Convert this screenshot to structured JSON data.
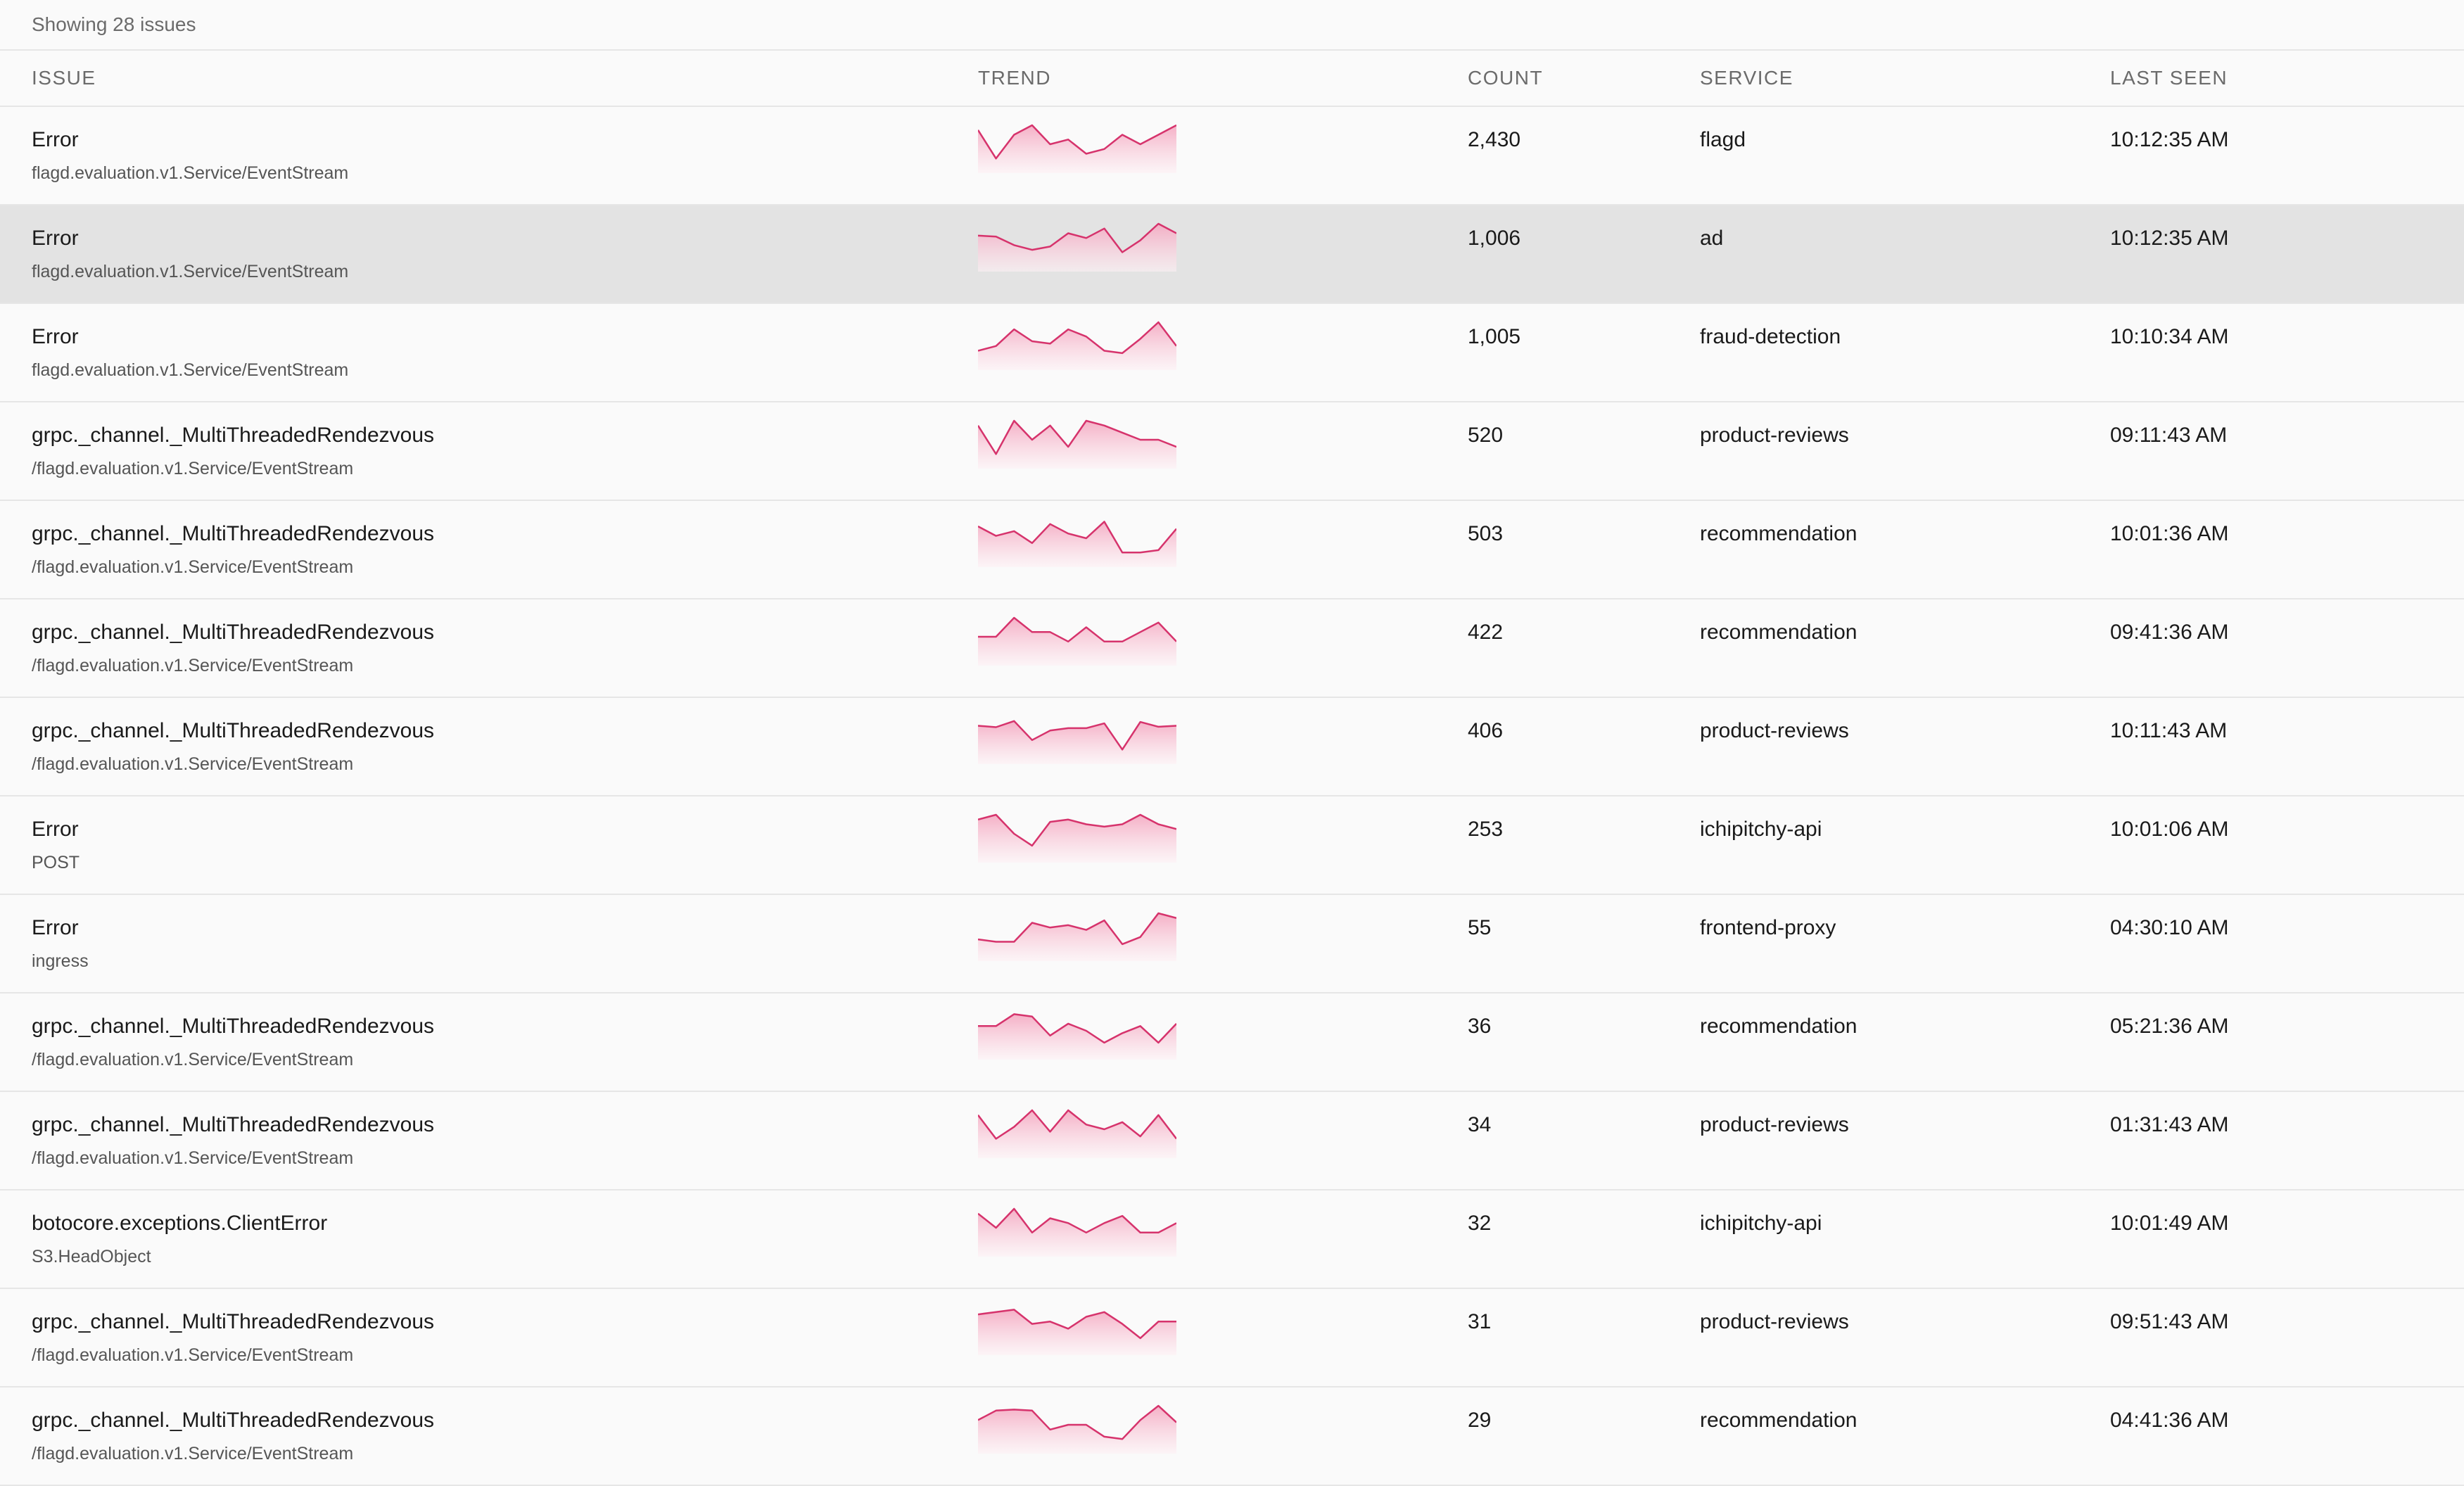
{
  "summary": "Showing 28 issues",
  "columns": {
    "issue": "ISSUE",
    "trend": "TREND",
    "count": "COUNT",
    "service": "SERVICE",
    "last_seen": "LAST SEEN"
  },
  "colors": {
    "sparkline_stroke": "#d6336c",
    "sparkline_fill_top": "#f4a7c0",
    "sparkline_fill_bottom": "#fdf0f4",
    "selected_row_bg": "#e3e3e3"
  },
  "rows": [
    {
      "title": "Error",
      "subtitle": "flagd.evaluation.v1.Service/EventStream",
      "count": "2,430",
      "service": "flagd",
      "last_seen": "10:12:35 AM",
      "selected": false,
      "trend": [
        7,
        1,
        6,
        8,
        4,
        5,
        2,
        3,
        6,
        4,
        6,
        8
      ]
    },
    {
      "title": "Error",
      "subtitle": "flagd.evaluation.v1.Service/EventStream",
      "count": "1,006",
      "service": "ad",
      "last_seen": "10:12:35 AM",
      "selected": true,
      "trend": [
        5.5,
        5.3,
        3.5,
        2.5,
        3.2,
        6,
        5,
        7,
        2,
        4.5,
        8,
        6
      ]
    },
    {
      "title": "Error",
      "subtitle": "flagd.evaluation.v1.Service/EventStream",
      "count": "1,005",
      "service": "fraud-detection",
      "last_seen": "10:10:34 AM",
      "selected": false,
      "trend": [
        2,
        3,
        6.5,
        4,
        3.5,
        6.5,
        5,
        2,
        1.5,
        4.5,
        8,
        3
      ]
    },
    {
      "title": "grpc._channel._MultiThreadedRendezvous",
      "subtitle": "/flagd.evaluation.v1.Service/EventStream",
      "count": "520",
      "service": "product-reviews",
      "last_seen": "09:11:43 AM",
      "selected": false,
      "trend": [
        7,
        1,
        8,
        4,
        7,
        2.5,
        8,
        7,
        5.5,
        4,
        4,
        2.5
      ]
    },
    {
      "title": "grpc._channel._MultiThreadedRendezvous",
      "subtitle": "/flagd.evaluation.v1.Service/EventStream",
      "count": "503",
      "service": "recommendation",
      "last_seen": "10:01:36 AM",
      "selected": false,
      "trend": [
        6.5,
        4.5,
        5.5,
        3,
        7,
        5,
        4,
        7.5,
        1,
        1,
        1.5,
        6
      ]
    },
    {
      "title": "grpc._channel._MultiThreadedRendezvous",
      "subtitle": "/flagd.evaluation.v1.Service/EventStream",
      "count": "422",
      "service": "recommendation",
      "last_seen": "09:41:36 AM",
      "selected": false,
      "trend": [
        4,
        4,
        8,
        5,
        5,
        3,
        6,
        3,
        3,
        5,
        7,
        3
      ]
    },
    {
      "title": "grpc._channel._MultiThreadedRendezvous",
      "subtitle": "/flagd.evaluation.v1.Service/EventStream",
      "count": "406",
      "service": "product-reviews",
      "last_seen": "10:11:43 AM",
      "selected": false,
      "trend": [
        6,
        5.7,
        7,
        3,
        5,
        5.5,
        5.5,
        6.5,
        1,
        6.8,
        5.8,
        6
      ]
    },
    {
      "title": "Error",
      "subtitle": "POST",
      "count": "253",
      "service": "ichipitchy-api",
      "last_seen": "10:01:06 AM",
      "selected": false,
      "trend": [
        7,
        8,
        4,
        1.5,
        6.5,
        7,
        6,
        5.5,
        6,
        8,
        6,
        5
      ]
    },
    {
      "title": "Error",
      "subtitle": "ingress",
      "count": "55",
      "service": "frontend-proxy",
      "last_seen": "04:30:10 AM",
      "selected": false,
      "trend": [
        2.5,
        2,
        2,
        6,
        5,
        5.5,
        4.5,
        6.5,
        1.5,
        3,
        8,
        7
      ]
    },
    {
      "title": "grpc._channel._MultiThreadedRendezvous",
      "subtitle": "/flagd.evaluation.v1.Service/EventStream",
      "count": "36",
      "service": "recommendation",
      "last_seen": "05:21:36 AM",
      "selected": false,
      "trend": [
        5,
        5,
        7.5,
        7,
        3,
        5.5,
        4,
        1.5,
        3.5,
        5,
        1.5,
        5.5
      ]
    },
    {
      "title": "grpc._channel._MultiThreadedRendezvous",
      "subtitle": "/flagd.evaluation.v1.Service/EventStream",
      "count": "34",
      "service": "product-reviews",
      "last_seen": "01:31:43 AM",
      "selected": false,
      "trend": [
        7,
        2,
        4.5,
        8,
        3.5,
        8,
        5,
        4,
        5.5,
        2.5,
        7,
        2
      ]
    },
    {
      "title": "botocore.exceptions.ClientError",
      "subtitle": "S3.HeadObject",
      "count": "32",
      "service": "ichipitchy-api",
      "last_seen": "10:01:49 AM",
      "selected": false,
      "trend": [
        7,
        4,
        8,
        3,
        6,
        5,
        3,
        5,
        6.5,
        3,
        3,
        5
      ]
    },
    {
      "title": "grpc._channel._MultiThreadedRendezvous",
      "subtitle": "/flagd.evaluation.v1.Service/EventStream",
      "count": "31",
      "service": "product-reviews",
      "last_seen": "09:51:43 AM",
      "selected": false,
      "trend": [
        6.5,
        7,
        7.5,
        4.5,
        5,
        3.5,
        6,
        7,
        4.5,
        1.5,
        5,
        5
      ]
    },
    {
      "title": "grpc._channel._MultiThreadedRendezvous",
      "subtitle": "/flagd.evaluation.v1.Service/EventStream",
      "count": "29",
      "service": "recommendation",
      "last_seen": "04:41:36 AM",
      "selected": false,
      "trend": [
        5,
        7,
        7.2,
        7,
        3,
        4,
        4,
        1.5,
        1,
        5,
        8,
        4.5
      ]
    }
  ]
}
